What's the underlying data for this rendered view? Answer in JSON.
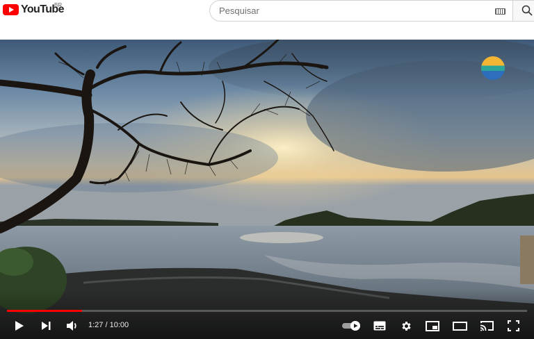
{
  "header": {
    "logo_text": "YouTube",
    "country_code": "BR",
    "search_placeholder": "Pesquisar"
  },
  "player": {
    "current_time": "1:27",
    "duration": "10:00",
    "time_display": "1:27 / 10:00",
    "progress_fraction": 0.145,
    "accent_color": "#ff0000"
  },
  "icons": {
    "play": "play-icon",
    "next": "next-icon",
    "volume": "volume-icon",
    "autoplay": "autoplay-toggle-icon",
    "subtitles": "subtitles-icon",
    "settings": "gear-icon",
    "miniplayer": "miniplayer-icon",
    "theater": "theater-mode-icon",
    "cast": "cast-icon",
    "fullscreen": "fullscreen-icon"
  }
}
